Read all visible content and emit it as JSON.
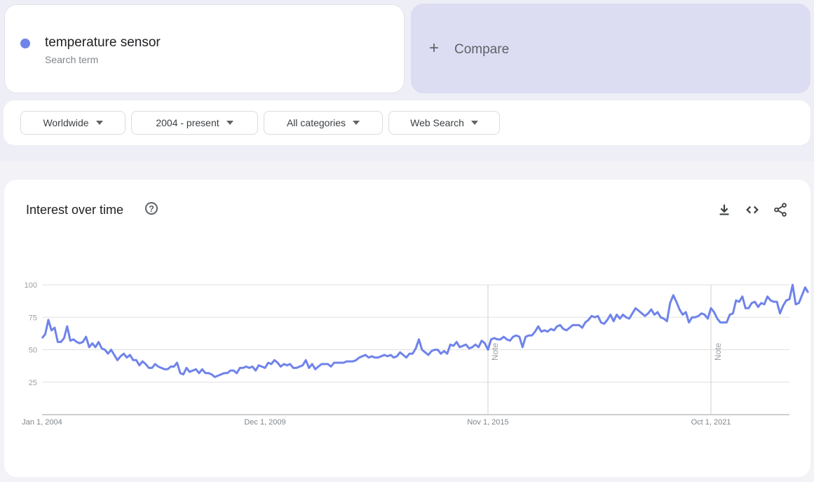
{
  "search_term": {
    "name": "temperature sensor",
    "label": "Search term",
    "color": "#6f83ea"
  },
  "compare": {
    "icon": "plus-icon",
    "label": "Compare"
  },
  "filters": [
    {
      "label": "Worldwide"
    },
    {
      "label": "2004 - present"
    },
    {
      "label": "All categories"
    },
    {
      "label": "Web Search"
    }
  ],
  "panel": {
    "title": "Interest over time",
    "help_icon": "help-icon",
    "tools": [
      "download-icon",
      "embed-code-icon",
      "share-icon"
    ]
  },
  "chart_data": {
    "type": "line",
    "title": "Interest over time",
    "xlabel": "",
    "ylabel": "",
    "ylim": [
      0,
      100
    ],
    "yticks": [
      25,
      50,
      75,
      100
    ],
    "xtick_labels": [
      "Jan 1, 2004",
      "Dec 1, 2009",
      "Nov 1, 2015",
      "Oct 1, 2021"
    ],
    "x_start": "2004-01",
    "frequency": "monthly",
    "grid": true,
    "annotations": [
      {
        "date": "2015-11",
        "label": "Note"
      },
      {
        "date": "2021-10",
        "label": "Note"
      }
    ],
    "series": [
      {
        "name": "temperature sensor",
        "color": "#6f83ea",
        "values": [
          59,
          62,
          73,
          65,
          67,
          56,
          56,
          59,
          68,
          57,
          58,
          56,
          55,
          56,
          60,
          52,
          55,
          52,
          56,
          51,
          50,
          47,
          50,
          46,
          42,
          45,
          47,
          44,
          46,
          42,
          42,
          38,
          41,
          39,
          36,
          36,
          39,
          37,
          36,
          35,
          35,
          37,
          37,
          40,
          32,
          31,
          36,
          33,
          34,
          35,
          32,
          35,
          32,
          32,
          31,
          29,
          30,
          31,
          32,
          32,
          34,
          34,
          32,
          36,
          36,
          37,
          36,
          37,
          34,
          38,
          37,
          36,
          40,
          39,
          42,
          40,
          37,
          39,
          38,
          39,
          36,
          36,
          37,
          38,
          42,
          36,
          39,
          35,
          37,
          39,
          39,
          39,
          37,
          40,
          40,
          40,
          40,
          41,
          41,
          41,
          42,
          44,
          45,
          46,
          44,
          45,
          44,
          44,
          45,
          46,
          45,
          46,
          44,
          45,
          48,
          46,
          44,
          47,
          47,
          51,
          58,
          50,
          48,
          46,
          49,
          50,
          50,
          47,
          49,
          47,
          54,
          53,
          56,
          52,
          53,
          54,
          51,
          52,
          54,
          52,
          57,
          55,
          50,
          58,
          59,
          58,
          58,
          60,
          58,
          57,
          60,
          61,
          60,
          52,
          60,
          61,
          61,
          64,
          68,
          64,
          65,
          64,
          66,
          65,
          68,
          69,
          66,
          65,
          67,
          69,
          69,
          69,
          67,
          71,
          73,
          76,
          75,
          76,
          71,
          70,
          73,
          77,
          72,
          77,
          74,
          77,
          75,
          74,
          78,
          82,
          80,
          78,
          76,
          78,
          81,
          77,
          79,
          75,
          74,
          72,
          86,
          92,
          87,
          81,
          77,
          79,
          71,
          75,
          75,
          76,
          78,
          77,
          74,
          82,
          79,
          74,
          71,
          71,
          71,
          77,
          78,
          88,
          87,
          91,
          82,
          82,
          86,
          87,
          83,
          86,
          85,
          91,
          88,
          87,
          87,
          78,
          84,
          88,
          89,
          100,
          85,
          86,
          92,
          98,
          94
        ]
      }
    ]
  }
}
